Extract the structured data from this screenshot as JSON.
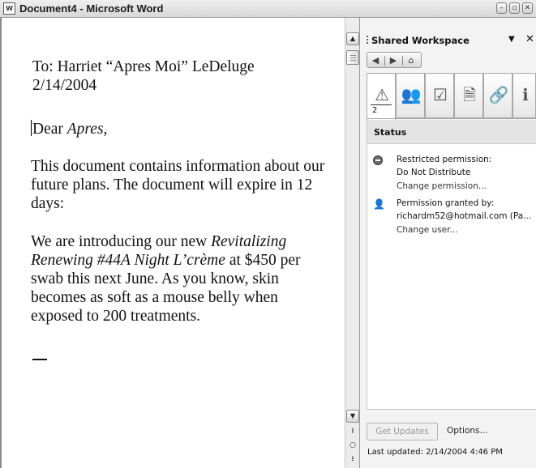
{
  "window": {
    "title": "Document4 - Microsoft Word",
    "app_icon": "word-document-icon",
    "buttons": [
      "minimize-icon",
      "restore-icon",
      "close-icon"
    ]
  },
  "document": {
    "to_line": "To: Harriet “Apres Moi” LeDeluge",
    "date_line": "2/14/2004",
    "salutation_prefix": "Dear ",
    "salutation_name": "Apres",
    "salutation_suffix": ",",
    "paragraph1": "This document contains information about our future plans. The document will expire in 12 days:",
    "paragraph2": {
      "part1": "We are introducing our new ",
      "italic": "Revitalizing Renewing #44A Night L’crème",
      "part2": " at $450 per swab this next June. As you know, skin becomes as soft as a mouse belly when exposed to 200 treatments."
    }
  },
  "task_pane": {
    "title": "Shared Workspace",
    "menu_icon": "dropdown-triangle-icon",
    "close_icon": "close-icon",
    "nav": [
      "back-icon",
      "forward-icon",
      "home-icon"
    ],
    "tabs": [
      {
        "icon": "warning-icon",
        "glyph": "⚠",
        "count": "2",
        "active": true
      },
      {
        "icon": "members-icon",
        "glyph": "👥",
        "count": ""
      },
      {
        "icon": "tasks-icon",
        "glyph": "☑",
        "count": ""
      },
      {
        "icon": "documents-icon",
        "glyph": "🗎",
        "count": ""
      },
      {
        "icon": "links-icon",
        "glyph": "🔗",
        "count": ""
      },
      {
        "icon": "information-icon",
        "glyph": "ℹ",
        "count": ""
      }
    ],
    "status_label": "Status",
    "items": [
      {
        "icon": "no-entry-icon",
        "line1": "Restricted permission:",
        "line2": "Do Not Distribute",
        "link": "Change permission..."
      },
      {
        "icon": "user-permission-icon",
        "line1": "Permission granted by:",
        "line2": "richardm52@hotmail.com (Pa...",
        "link": "Change user..."
      }
    ],
    "get_updates": "Get Updates",
    "options": "Options...",
    "last_updated": "Last updated: 2/14/2004 4:46 PM"
  },
  "scrollbar": {
    "up": "▲",
    "down": "▼",
    "prev_page": "⭱",
    "select_browse": "○",
    "next_page": "⭳"
  }
}
